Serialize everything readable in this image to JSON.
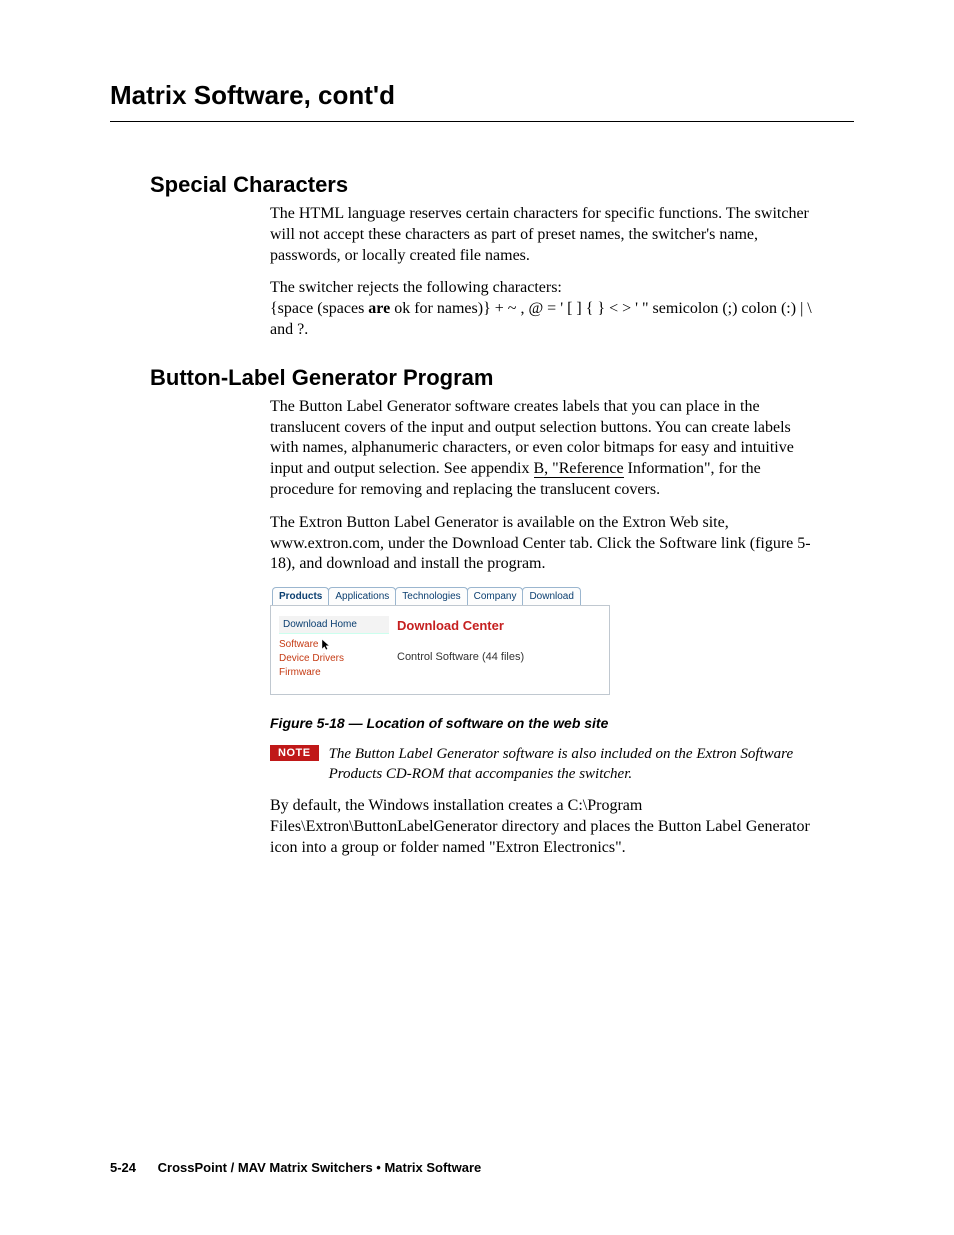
{
  "header": {
    "running": "Matrix Software, cont'd"
  },
  "sections": {
    "special": {
      "title": "Special Characters",
      "p1": "The HTML language reserves certain characters for specific functions.  The switcher will not accept these characters as part of preset names, the switcher's name, passwords, or locally created file names.",
      "p2_lead": "The switcher rejects the following characters:",
      "p2_chars_pre": "{space (spaces ",
      "p2_are": "are",
      "p2_chars_post": " ok for names)}  +  ~  ,  @  =  '  [  ]  {  }  <  >  '  \"  semicolon (;)  colon (:)  |  \\  and ?."
    },
    "blg": {
      "title": "Button-Label Generator Program",
      "p1_pre": "The Button Label Generator software creates labels that you can place in the translucent covers of the input and output selection buttons.  You can create labels with names, alphanumeric characters, or even color bitmaps for easy and intuitive input and output selection.  See appendix ",
      "p1_link": "B, \"Reference",
      "p1_post": " Information\", for the procedure for removing and replacing the translucent covers.",
      "p2": "The Extron Button Label Generator is available on the Extron Web site, www.extron.com, under the Download Center tab.  Click the Software link (figure 5-18), and download and install the program.",
      "figure": {
        "tabs": [
          "Products",
          "Applications",
          "Technologies",
          "Company",
          "Download"
        ],
        "active_tab_index": 0,
        "sidebar": {
          "home": "Download Home",
          "links": [
            "Software",
            "Device Drivers",
            "Firmware"
          ]
        },
        "main": {
          "title": "Download Center",
          "line": "Control Software (44 files)"
        },
        "caption": "Figure 5-18 — Location of software on the web site"
      },
      "note": {
        "badge": "NOTE",
        "text": "The Button Label Generator software is also included on the Extron Software Products CD-ROM that accompanies the switcher."
      },
      "p3": "By default, the Windows installation creates a C:\\Program Files\\Extron\\ButtonLabelGenerator directory and places the Button Label Generator icon into a group or folder named \"Extron Electronics\"."
    }
  },
  "footer": {
    "page": "5-24",
    "text": "CrossPoint / MAV Matrix Switchers • Matrix Software"
  }
}
